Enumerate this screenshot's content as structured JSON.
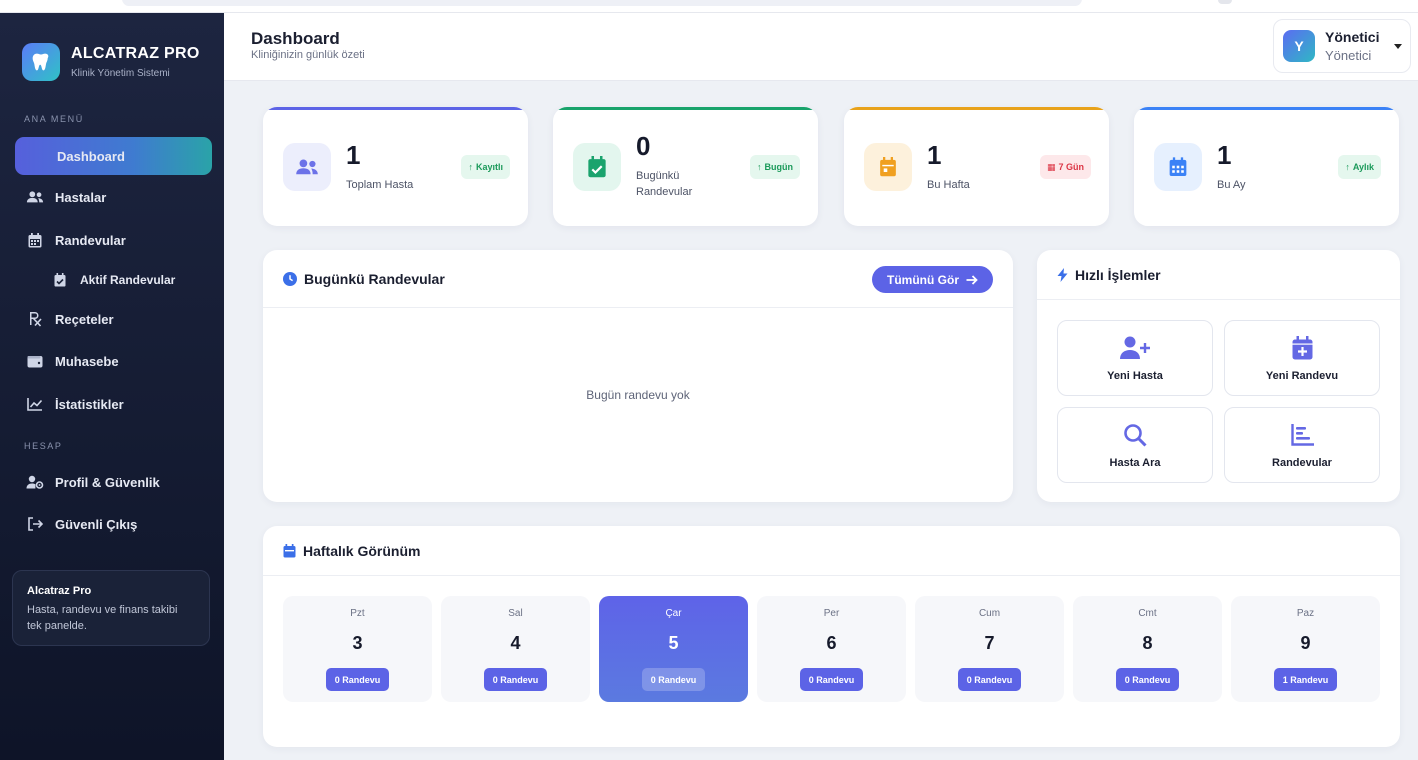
{
  "brand": {
    "title": "ALCATRAZ PRO",
    "subtitle": "Klinik Yönetim Sistemi"
  },
  "sidebar": {
    "section_main": "ANA MENÜ",
    "section_account": "HESAP",
    "items": [
      {
        "label": "Dashboard",
        "icon": "dashboard",
        "active": true
      },
      {
        "label": "Hastalar",
        "icon": "users-icon"
      },
      {
        "label": "Randevular",
        "icon": "calendar-icon"
      },
      {
        "label": "Aktif Randevular",
        "icon": "calendar-check-icon",
        "sub": true
      },
      {
        "label": "Reçeteler",
        "icon": "prescription-icon"
      },
      {
        "label": "Muhasebe",
        "icon": "wallet-icon"
      },
      {
        "label": "İstatistikler",
        "icon": "chart-line-icon"
      }
    ],
    "account_items": [
      {
        "label": "Profil & Güvenlik",
        "icon": "user-gear-icon"
      },
      {
        "label": "Güvenli Çıkış",
        "icon": "logout-icon"
      }
    ],
    "card": {
      "title": "Alcatraz Pro",
      "desc": "Hasta, randevu ve finans takibi tek panelde."
    }
  },
  "header": {
    "title": "Dashboard",
    "subtitle": "Kliniğinizin günlük özeti"
  },
  "user": {
    "initial": "Y",
    "name": "Yönetici",
    "role": "Yönetici"
  },
  "stats": [
    {
      "value": "1",
      "label": "Toplam Hasta",
      "badge": "Kayıtlı",
      "badge_style": "green",
      "accent": "#5c63e6"
    },
    {
      "value": "0",
      "label": "Bugünkü Randevular",
      "badge": "Bugün",
      "badge_style": "green",
      "accent": "#18a36b"
    },
    {
      "value": "1",
      "label": "Bu Hafta",
      "badge": "7 Gün",
      "badge_style": "red",
      "accent": "#e8a21a"
    },
    {
      "value": "1",
      "label": "Bu Ay",
      "badge": "Aylık",
      "badge_style": "green",
      "accent": "#3b82f6"
    }
  ],
  "today": {
    "title": "Bugünkü Randevular",
    "button": "Tümünü Gör",
    "empty": "Bugün randevu yok"
  },
  "quick": {
    "title": "Hızlı İşlemler",
    "actions": [
      {
        "label": "Yeni Hasta",
        "icon": "user-plus-icon"
      },
      {
        "label": "Yeni Randevu",
        "icon": "calendar-plus-icon"
      },
      {
        "label": "Hasta Ara",
        "icon": "search-icon"
      },
      {
        "label": "Randevular",
        "icon": "list-chart-icon"
      }
    ]
  },
  "weekly": {
    "title": "Haftalık Görünüm",
    "days": [
      {
        "name": "Pzt",
        "date": "3",
        "count": "0 Randevu"
      },
      {
        "name": "Sal",
        "date": "4",
        "count": "0 Randevu"
      },
      {
        "name": "Çar",
        "date": "5",
        "count": "0 Randevu",
        "today": true
      },
      {
        "name": "Per",
        "date": "6",
        "count": "0 Randevu"
      },
      {
        "name": "Cum",
        "date": "7",
        "count": "0 Randevu"
      },
      {
        "name": "Cmt",
        "date": "8",
        "count": "0 Randevu"
      },
      {
        "name": "Paz",
        "date": "9",
        "count": "1 Randevu"
      }
    ]
  }
}
